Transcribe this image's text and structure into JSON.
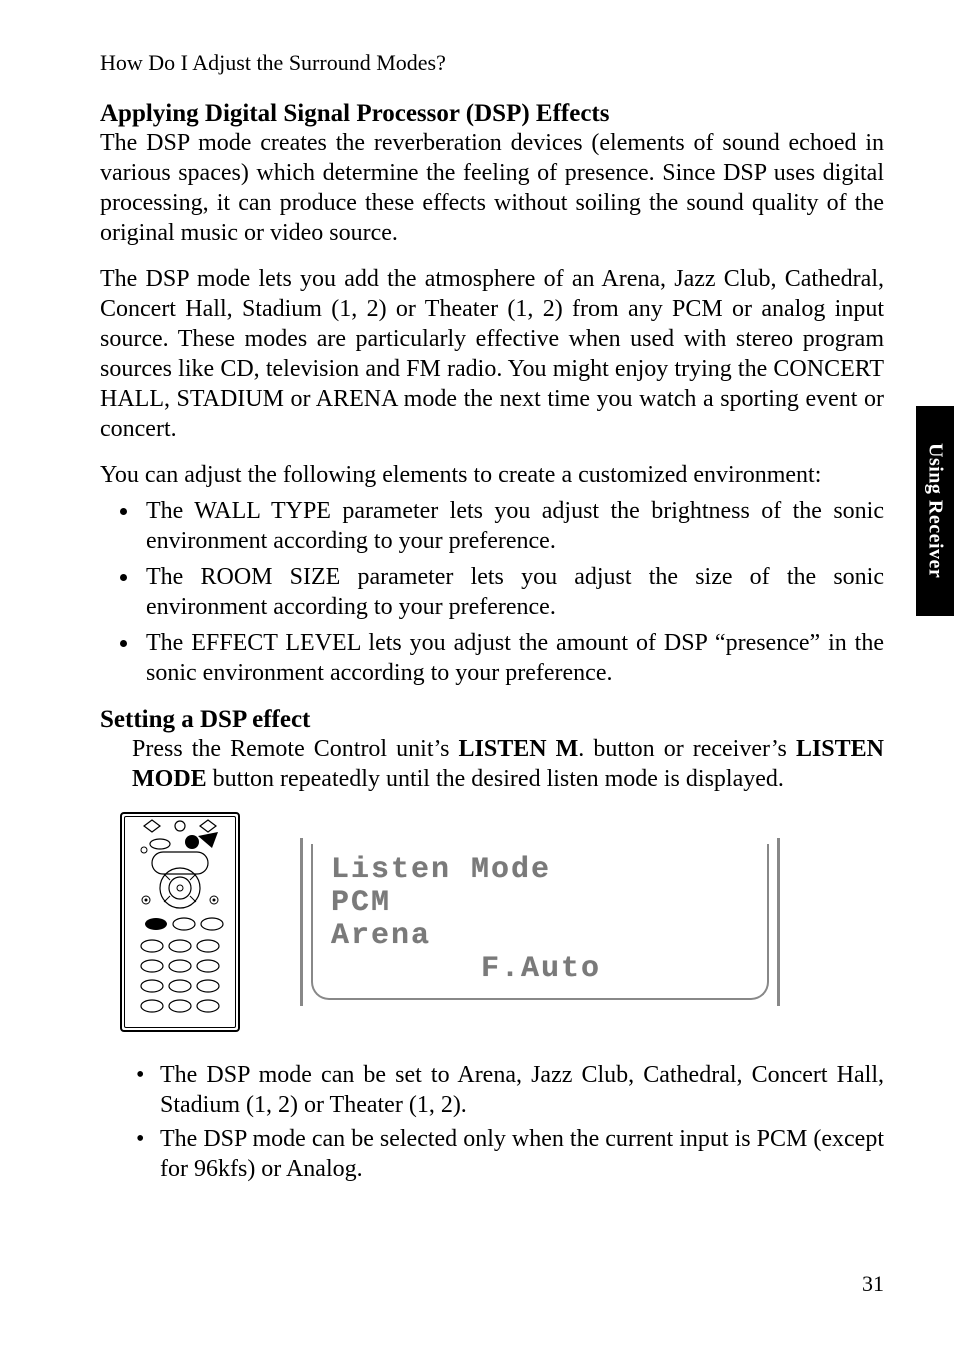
{
  "header": {
    "running_head": "How Do I Adjust the Surround Modes?"
  },
  "section1": {
    "title": "Applying Digital Signal Processor (DSP) Effects",
    "p1": "The DSP mode creates the reverberation devices (elements of sound echoed in various spaces) which determine the feeling of presence. Since DSP uses digital processing, it can produce these effects without soiling the sound quality of the original music or video source.",
    "p2": "The DSP mode lets you add the atmosphere of an Arena, Jazz Club, Cathedral, Concert Hall, Stadium (1, 2) or Theater (1, 2) from any PCM or analog input source. These modes are particularly effective when used with stereo program sources like CD, television and FM radio. You might enjoy trying the CONCERT HALL, STADIUM or ARENA mode the next time you watch a sporting event or concert.",
    "p3": "You can adjust the following elements to create a customized environment:",
    "bullets": [
      "The WALL TYPE parameter lets you adjust the brightness of the sonic environment according to your preference.",
      "The ROOM SIZE parameter lets you adjust the size of the sonic environment according to your preference.",
      "The EFFECT LEVEL lets you adjust the amount of DSP “presence” in the sonic environment according to your preference."
    ]
  },
  "section2": {
    "title": "Setting a DSP effect",
    "p1_pre": "Press the Remote Control unit’s ",
    "p1_b1": "LISTEN M",
    "p1_mid1": ". button or receiver’s ",
    "p1_b2": "LISTEN MODE",
    "p1_post": " button repeatedly until the desired listen mode is displayed.",
    "display": {
      "line1": "Listen Mode",
      "line2": "PCM",
      "line3": "Arena",
      "line4": "F.Auto"
    },
    "notes": [
      "The DSP mode can be set to Arena, Jazz Club, Cathedral, Concert Hall, Stadium (1, 2) or Theater (1, 2).",
      "The DSP mode can be selected only when the current input is PCM (except for 96kfs) or Analog."
    ]
  },
  "side_tab": "Using Receiver",
  "page_number": "31"
}
